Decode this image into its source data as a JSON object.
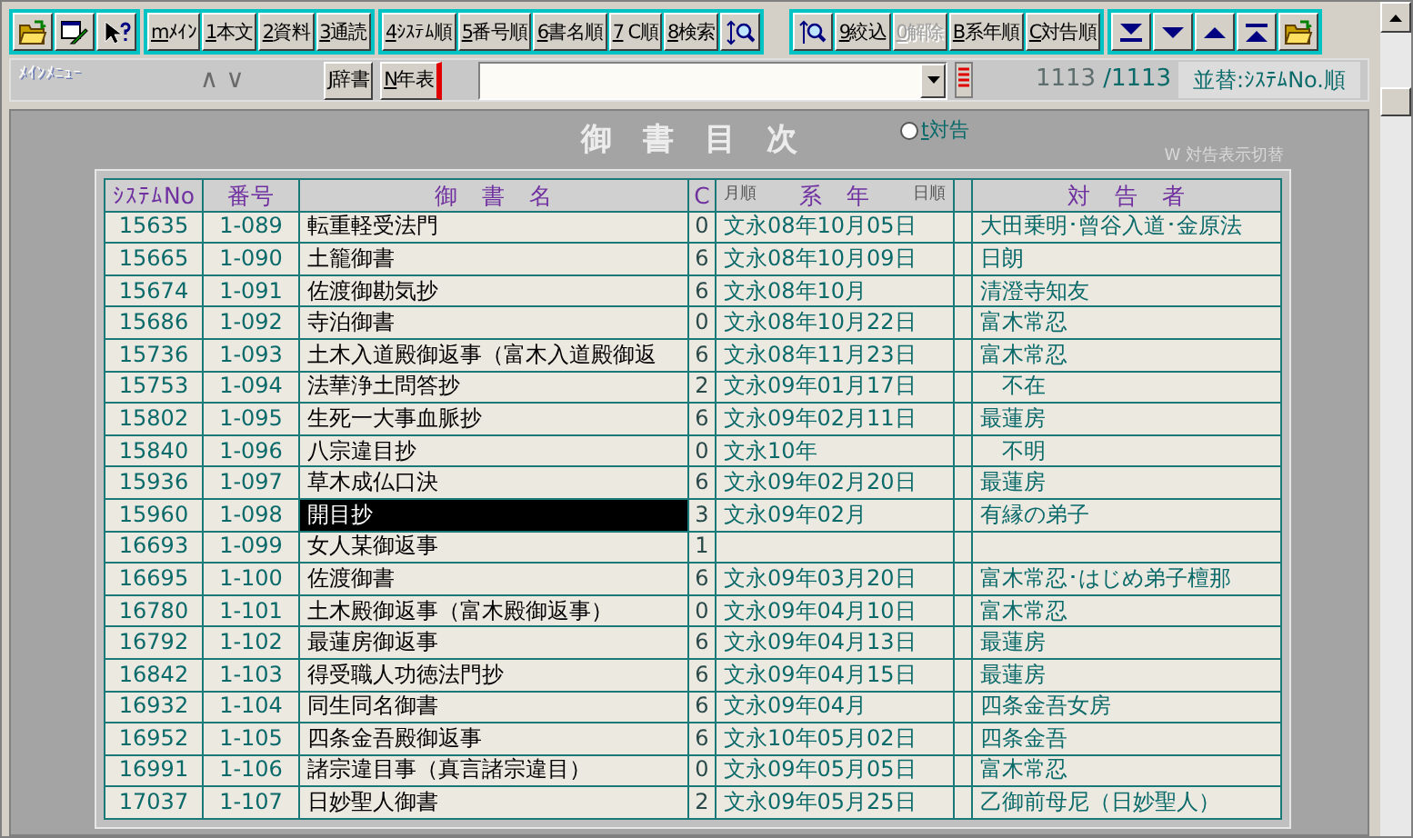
{
  "toolbar": {
    "groups": [
      [
        {
          "kind": "icon"
        },
        {
          "kind": "icon"
        },
        {
          "kind": "icon"
        }
      ],
      [
        {
          "kind": "text",
          "key": "m",
          "label": "ﾒｲﾝ",
          "disabled": false
        },
        {
          "kind": "text",
          "key": "1",
          "label": "本文",
          "disabled": false
        },
        {
          "kind": "text",
          "key": "2",
          "label": "資料",
          "disabled": false
        },
        {
          "kind": "text",
          "key": "3",
          "label": "通読",
          "disabled": false
        }
      ],
      [
        {
          "kind": "text",
          "key": "4",
          "label": "ｼｽﾃﾑ順",
          "disabled": false
        },
        {
          "kind": "text",
          "key": "5",
          "label": "番号順",
          "disabled": false
        },
        {
          "kind": "text",
          "key": "6",
          "label": "書名順",
          "disabled": false
        },
        {
          "kind": "text",
          "key": "7",
          "label": " C順",
          "disabled": false
        },
        {
          "kind": "text",
          "key": "8",
          "label": "検索",
          "disabled": false
        },
        {
          "kind": "icon"
        }
      ],
      [
        {
          "kind": "icon"
        },
        {
          "kind": "text",
          "key": "9",
          "label": "絞込",
          "disabled": false
        },
        {
          "kind": "text",
          "key": "0",
          "label": "解除",
          "disabled": true
        },
        {
          "kind": "text",
          "key": "B",
          "label": "系年順",
          "disabled": false
        },
        {
          "kind": "text",
          "key": "C",
          "label": "対告順",
          "disabled": false
        }
      ],
      [
        {
          "kind": "icon"
        },
        {
          "kind": "icon"
        },
        {
          "kind": "icon"
        },
        {
          "kind": "icon"
        },
        {
          "kind": "icon"
        }
      ]
    ]
  },
  "menu_bar": {
    "label": "ﾒｲﾝﾒﾆｭｰ",
    "arrows": [
      "∧",
      "∨"
    ],
    "buttons": [
      {
        "key": "J",
        "label": "辞書"
      },
      {
        "key": "N",
        "label": "年表"
      }
    ],
    "count": "1113",
    "total": "/1113",
    "sort_label": "並替:ｼｽﾃﾑNo.順"
  },
  "title": "御　書　目　次",
  "radio": {
    "key": "t",
    "label": "対告",
    "checked": false
  },
  "hint": "W 対告表示切替",
  "table": {
    "columns": [
      "ｼｽﾃﾑNo",
      "番号",
      "御　書　名",
      "C"
    ],
    "date_header": {
      "left": "月順",
      "center": "系　年",
      "right": "日順"
    },
    "recipient_header": "対　告　者",
    "rows": [
      {
        "sys": "15635",
        "num": "1-089",
        "name": "転重軽受法門",
        "c": "0",
        "date": "文永08年10月05日",
        "to": "大田乗明･曾谷入道･金原法",
        "selected": false
      },
      {
        "sys": "15665",
        "num": "1-090",
        "name": "土籠御書",
        "c": "6",
        "date": "文永08年10月09日",
        "to": "日朗",
        "selected": false
      },
      {
        "sys": "15674",
        "num": "1-091",
        "name": "佐渡御勘気抄",
        "c": "6",
        "date": "文永08年10月",
        "to": "清澄寺知友",
        "selected": false
      },
      {
        "sys": "15686",
        "num": "1-092",
        "name": "寺泊御書",
        "c": "0",
        "date": "文永08年10月22日",
        "to": "富木常忍",
        "selected": false
      },
      {
        "sys": "15736",
        "num": "1-093",
        "name": "土木入道殿御返事（富木入道殿御返",
        "c": "6",
        "date": "文永08年11月23日",
        "to": "富木常忍",
        "selected": false
      },
      {
        "sys": "15753",
        "num": "1-094",
        "name": "法華浄土問答抄",
        "c": "2",
        "date": "文永09年01月17日",
        "to": "　不在",
        "selected": false
      },
      {
        "sys": "15802",
        "num": "1-095",
        "name": "生死一大事血脈抄",
        "c": "6",
        "date": "文永09年02月11日",
        "to": "最蓮房",
        "selected": false
      },
      {
        "sys": "15840",
        "num": "1-096",
        "name": "八宗違目抄",
        "c": "0",
        "date": "文永10年",
        "to": "　不明",
        "selected": false
      },
      {
        "sys": "15936",
        "num": "1-097",
        "name": "草木成仏口決",
        "c": "6",
        "date": "文永09年02月20日",
        "to": "最蓮房",
        "selected": false
      },
      {
        "sys": "15960",
        "num": "1-098",
        "name": "開目抄",
        "c": "3",
        "date": "文永09年02月",
        "to": "有縁の弟子",
        "selected": true
      },
      {
        "sys": "16693",
        "num": "1-099",
        "name": "女人某御返事",
        "c": "1",
        "selected": false
      },
      {
        "sys": "16695",
        "num": "1-100",
        "name": "佐渡御書",
        "c": "6",
        "date": "文永09年03月20日",
        "to": "富木常忍･はじめ弟子檀那",
        "selected": false
      },
      {
        "sys": "16780",
        "num": "1-101",
        "name": "土木殿御返事（富木殿御返事）",
        "c": "0",
        "date": "文永09年04月10日",
        "to": "富木常忍",
        "selected": false
      },
      {
        "sys": "16792",
        "num": "1-102",
        "name": "最蓮房御返事",
        "c": "6",
        "date": "文永09年04月13日",
        "to": "最蓮房",
        "selected": false
      },
      {
        "sys": "16842",
        "num": "1-103",
        "name": "得受職人功徳法門抄",
        "c": "6",
        "date": "文永09年04月15日",
        "to": "最蓮房",
        "selected": false
      },
      {
        "sys": "16932",
        "num": "1-104",
        "name": "同生同名御書",
        "c": "6",
        "date": "文永09年04月",
        "to": "四条金吾女房",
        "selected": false
      },
      {
        "sys": "16952",
        "num": "1-105",
        "name": "四条金吾殿御返事",
        "c": "6",
        "date": "文永10年05月02日",
        "to": "四条金吾",
        "selected": false
      },
      {
        "sys": "16991",
        "num": "1-106",
        "name": "諸宗違目事（真言諸宗違目）",
        "c": "0",
        "date": "文永09年05月05日",
        "to": "富木常忍",
        "selected": false
      },
      {
        "sys": "17037",
        "num": "1-107",
        "name": "日妙聖人御書",
        "c": "2",
        "date": "文永09年05月25日",
        "to": "乙御前母尼（日妙聖人）",
        "selected": false
      }
    ]
  }
}
